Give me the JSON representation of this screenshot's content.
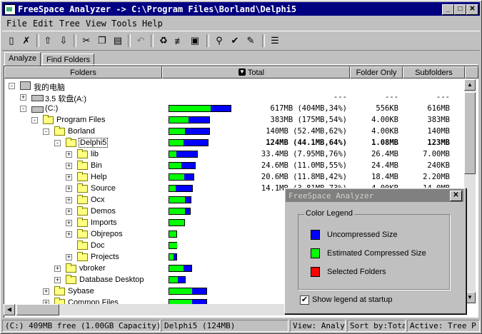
{
  "window": {
    "title": "FreeSpace Analyzer -> C:\\Program Files\\Borland\\Delphi5"
  },
  "menu": [
    "File",
    "Edit",
    "Tree",
    "View",
    "Tools",
    "Help"
  ],
  "tabs": [
    "Analyze",
    "Find Folders"
  ],
  "columns": {
    "folders": "Folders",
    "total": "Total",
    "folder_only": "Folder Only",
    "subfolders": "Subfolders"
  },
  "tree": [
    {
      "label": "我的电脑",
      "total": "",
      "folder_only": "",
      "subfolders": ""
    },
    {
      "label": "3.5 软盘(A:)",
      "total": "---",
      "folder_only": "---",
      "subfolders": "---"
    },
    {
      "label": "(C:)",
      "total": "617MB (404MB,34%)",
      "folder_only": "556KB",
      "subfolders": "616MB",
      "ratio": 0.34
    },
    {
      "label": "Program Files",
      "total": "383MB (175MB,54%)",
      "folder_only": "4.00KB",
      "subfolders": "383MB",
      "ratio": 0.54
    },
    {
      "label": "Borland",
      "total": "140MB (52.4MB,62%)",
      "folder_only": "4.00KB",
      "subfolders": "140MB",
      "ratio": 0.62
    },
    {
      "label": "Delphi5",
      "total": "124MB (44.1MB,64%)",
      "folder_only": "1.08MB",
      "subfolders": "123MB",
      "ratio": 0.64,
      "selected": true
    },
    {
      "label": "lib",
      "total": "33.4MB (7.95MB,76%)",
      "folder_only": "26.4MB",
      "subfolders": "7.00MB",
      "ratio": 0.76
    },
    {
      "label": "Bin",
      "total": "24.6MB (11.0MB,55%)",
      "folder_only": "24.4MB",
      "subfolders": "240KB",
      "ratio": 0.55
    },
    {
      "label": "Help",
      "total": "20.6MB (11.8MB,42%)",
      "folder_only": "18.4MB",
      "subfolders": "2.20MB",
      "ratio": 0.42
    },
    {
      "label": "Source",
      "total": "14.1MB (3.81MB,73%)",
      "folder_only": "4.00KB",
      "subfolders": "14.0MB",
      "ratio": 0.73
    },
    {
      "label": "Ocx",
      "total": "13.1",
      "folder_only": "",
      "subfolders": "",
      "ratio": 0.3
    },
    {
      "label": "Demos",
      "total": "12.0",
      "folder_only": "",
      "subfolders": "",
      "ratio": 0.3
    },
    {
      "label": "Imports",
      "total": "4.0",
      "folder_only": "",
      "subfolders": "",
      "ratio": 0.1
    },
    {
      "label": "Objrepos",
      "total": "34",
      "folder_only": "",
      "subfolders": "",
      "ratio": 0.2
    },
    {
      "label": "Doc",
      "total": "30",
      "folder_only": "",
      "subfolders": "",
      "ratio": 0.1
    },
    {
      "label": "Projects",
      "total": "30",
      "folder_only": "",
      "subfolders": "",
      "ratio": 0.5
    },
    {
      "label": "vbroker",
      "total": "12.6",
      "folder_only": "",
      "subfolders": "",
      "ratio": 0.4
    },
    {
      "label": "Database Desktop",
      "total": "3.70",
      "folder_only": "",
      "subfolders": "",
      "ratio": 0.5
    },
    {
      "label": "Sybase",
      "total": "95.9",
      "folder_only": "",
      "subfolders": "",
      "ratio": 0.4
    },
    {
      "label": "Common Files",
      "total": "90.5",
      "folder_only": "",
      "subfolders": "",
      "ratio": 0.4
    }
  ],
  "status": {
    "drive": "(C:)  409MB free (1.00GB Capacity)",
    "folder": "Delphi5 (124MB)",
    "view": "View: Analyze",
    "sort": "Sort by:Total",
    "active": "Active: Tree P"
  },
  "legend": {
    "title": "FreeSpace Analyzer",
    "group": "Color Legend",
    "items": [
      {
        "label": "Uncompressed Size",
        "color": "#0000ff"
      },
      {
        "label": "Estimated Compressed Size",
        "color": "#00ff00"
      },
      {
        "label": "Selected Folders",
        "color": "#ff0000"
      }
    ],
    "checkbox_label": "Show legend at startup",
    "checked": true
  }
}
